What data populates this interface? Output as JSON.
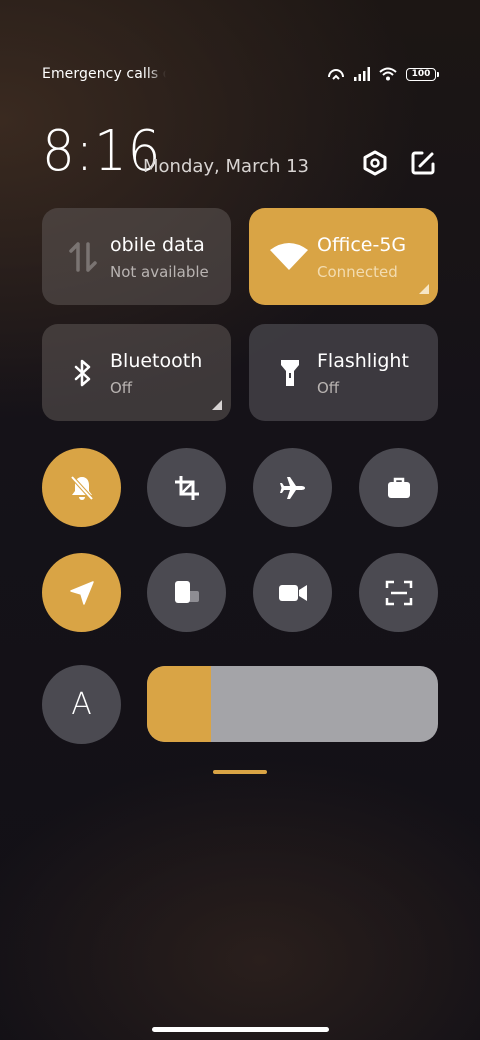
{
  "status_bar": {
    "carrier_text": "Emergency calls only",
    "battery_level": "100",
    "icons": [
      "hotspot-icon",
      "signal-icon",
      "wifi-icon",
      "battery-icon"
    ]
  },
  "header": {
    "time": "8:16",
    "date": "Monday, March 13",
    "icons": [
      "settings-icon",
      "edit-icon"
    ]
  },
  "tiles": [
    {
      "label": "Mobile data",
      "label_visible": "obile data",
      "sub": "Not available",
      "state": "unavailable",
      "icon": "mobile-data-icon"
    },
    {
      "label": "Office-5G",
      "sub": "Connected",
      "state": "on",
      "icon": "wifi-icon"
    },
    {
      "label": "Bluetooth",
      "sub": "Off",
      "state": "off",
      "icon": "bluetooth-icon"
    },
    {
      "label": "Flashlight",
      "sub": "Off",
      "state": "off",
      "icon": "flashlight-icon"
    }
  ],
  "toggles": [
    {
      "name": "mute",
      "icon": "bell-off-icon",
      "state": "on"
    },
    {
      "name": "screenshot",
      "icon": "crop-icon",
      "state": "off"
    },
    {
      "name": "airplane-mode",
      "icon": "airplane-icon",
      "state": "off"
    },
    {
      "name": "work-profile",
      "icon": "briefcase-icon",
      "state": "off"
    },
    {
      "name": "location",
      "icon": "location-arrow-icon",
      "state": "on"
    },
    {
      "name": "floating-window",
      "icon": "floating-window-icon",
      "state": "off"
    },
    {
      "name": "screen-recorder",
      "icon": "video-camera-icon",
      "state": "off"
    },
    {
      "name": "scanner",
      "icon": "scan-icon",
      "state": "off"
    }
  ],
  "auto_brightness": {
    "label": "A",
    "state": "off"
  },
  "brightness": {
    "level": 0.22
  },
  "colors": {
    "accent": "#d9a445",
    "tile_off": "#4b4a51",
    "slider_track": "#a4a4a8"
  }
}
